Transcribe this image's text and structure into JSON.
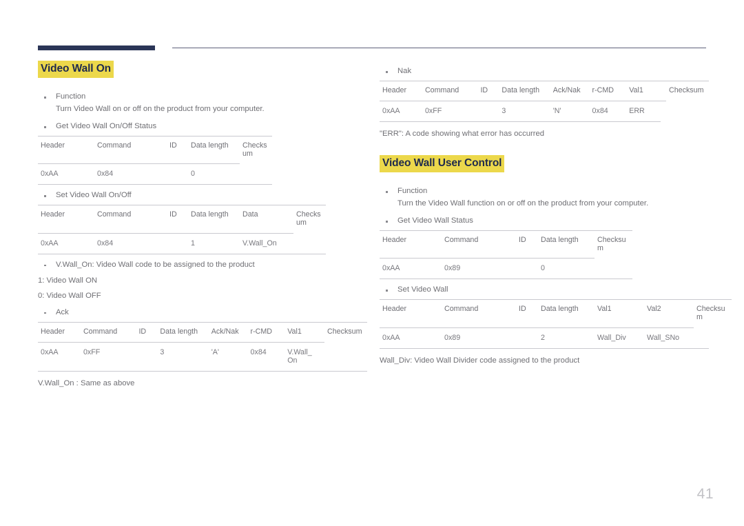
{
  "page": {
    "number": "41"
  },
  "left_column": {
    "heading": "Video Wall On",
    "function_label": "Function",
    "function_text": "Turn Video Wall on or off on the product from your computer.",
    "get_status_label": "Get Video Wall On/Off Status",
    "get_status_table": {
      "columns": [
        "Header",
        "Command",
        "ID",
        "Data length",
        "Checksum"
      ],
      "rows": [
        [
          "0xAA",
          "0x84",
          "",
          "0",
          ""
        ]
      ]
    },
    "set_label": "Set Video Wall On/Off",
    "set_table": {
      "columns": [
        "Header",
        "Command",
        "ID",
        "Data length",
        "Data",
        "Checksum"
      ],
      "rows": [
        [
          "0xAA",
          "0x84",
          "",
          "1",
          "V.Wall_On",
          ""
        ]
      ]
    },
    "vwall_note": "V.Wall_On: Video Wall code to be assigned to the product",
    "value_on": "1: Video Wall ON",
    "value_off": "0: Video Wall OFF",
    "ack_label": "Ack",
    "ack_table": {
      "columns": [
        "Header",
        "Command",
        "ID",
        "Data length",
        "Ack/Nak",
        "r-CMD",
        "Val1",
        "Checksum"
      ],
      "rows": [
        [
          "0xAA",
          "0xFF",
          "",
          "3",
          "'A'",
          "0x84",
          "V.Wall_\nOn",
          ""
        ]
      ]
    },
    "same_as_above": "V.Wall_On : Same as above"
  },
  "right_column": {
    "nak_label": "Nak",
    "nak_table": {
      "columns": [
        "Header",
        "Command",
        "ID",
        "Data length",
        "Ack/Nak",
        "r-CMD",
        "Val1",
        "Checksum"
      ],
      "rows": [
        [
          "0xAA",
          "0xFF",
          "",
          "3",
          "'N'",
          "0x84",
          "ERR",
          ""
        ]
      ]
    },
    "err_note": "\"ERR\": A code showing what error has occurred",
    "heading": "Video Wall User Control",
    "function_label": "Function",
    "function_text": "Turn the Video Wall function on or off on the product from your computer.",
    "get_status_label": "Get Video Wall Status",
    "get_status_table": {
      "columns": [
        "Header",
        "Command",
        "ID",
        "Data length",
        "Checksum"
      ],
      "rows": [
        [
          "0xAA",
          "0x89",
          "",
          "0",
          ""
        ]
      ]
    },
    "set_label": "Set Video Wall",
    "set_table": {
      "columns": [
        "Header",
        "Command",
        "ID",
        "Data length",
        "Val1",
        "Val2",
        "Checksum"
      ],
      "rows": [
        [
          "0xAA",
          "0x89",
          "",
          "2",
          "Wall_Div",
          "Wall_SNo",
          ""
        ]
      ]
    },
    "wall_div_note": "Wall_Div: Video Wall Divider code assigned to the product"
  },
  "colors": {
    "highlight": "#ecd84b",
    "heading_text": "#1f2a4d",
    "header_bar": "#2b3557",
    "rule": "#c9c9cf",
    "body_text": "#6f6f74"
  }
}
